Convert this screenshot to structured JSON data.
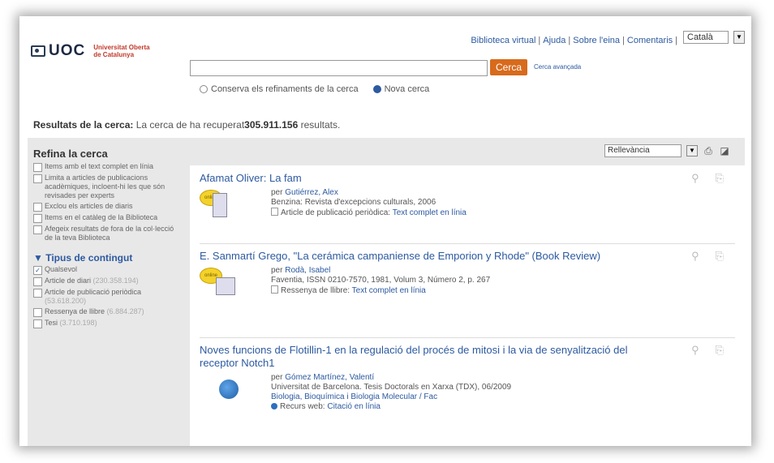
{
  "header": {
    "logo_text": "UOC",
    "logo_sub1": "Universitat Oberta",
    "logo_sub2": "de Catalunya",
    "links": [
      "Biblioteca virtual",
      "Ajuda",
      "Sobre l'eina",
      "Comentaris"
    ],
    "language": "Català"
  },
  "search": {
    "value": "",
    "button_label": "Cerca",
    "advanced_label": "Cerca avançada",
    "radio_keep": "Conserva els refinaments de la cerca",
    "radio_new": "Nova cerca"
  },
  "results_summary": {
    "label": "Resultats de la cerca:",
    "text": "La cerca de ha recuperat",
    "count": "305.911.156",
    "suffix": "resultats."
  },
  "sidebar": {
    "title": "Refina la cerca",
    "refinements": [
      "Items amb el text complet en línia",
      "Limita a articles de publicacions acadèmiques, incloent-hi les que són revisades per experts",
      "Exclou els articles de diaris",
      "Items en el catàleg de la Biblioteca",
      "Afegeix resultats de fora de la col·lecció de la teva Biblioteca"
    ],
    "facet_title": "Tipus de contingut",
    "content_types": [
      {
        "label": "Qualsevol",
        "count": "",
        "checked": true
      },
      {
        "label": "Article de diari",
        "count": "(230.358.194)",
        "checked": false
      },
      {
        "label": "Article de publicació periòdica",
        "count": "(53.618.200)",
        "checked": false
      },
      {
        "label": "Ressenya de llibre",
        "count": "(6.884.287)",
        "checked": false
      },
      {
        "label": "Tesi",
        "count": "(3.710.198)",
        "checked": false
      }
    ]
  },
  "sort": {
    "value": "Rellevància"
  },
  "results": [
    {
      "title": "Afamat Oliver: La fam",
      "author_prefix": "per",
      "author": "Gutiérrez, Alex",
      "source": "Benzina: Revista d'excepcions culturals, 2006",
      "subject": "",
      "type": "Article de publicació periòdica:",
      "access": "Text complet en línia",
      "badge": "online"
    },
    {
      "title": "E. Sanmartí Grego, \"La cerámica campaniense de Emporion y Rhode\" (Book Review)",
      "author_prefix": "per",
      "author": "Rodà, Isabel",
      "source": "Faventia, ISSN 0210-7570, 1981, Volum 3, Número 2, p. 267",
      "subject": "",
      "type": "Ressenya de llibre:",
      "access": "Text complet en línia",
      "badge": "online"
    },
    {
      "title": "Noves funcions de Flotillin-1 en la regulació del procés de mitosi i la via de senyalització del receptor Notch1",
      "author_prefix": "per",
      "author": "Gómez Martínez, Valentí",
      "source": "Universitat de Barcelona. Tesis Doctorals en Xarxa (TDX), 06/2009",
      "subject": "Biologia, Bioquímica i Biologia Molecular / Fac",
      "type": "Recurs web:",
      "access": "Citació en línia",
      "badge": ""
    }
  ]
}
